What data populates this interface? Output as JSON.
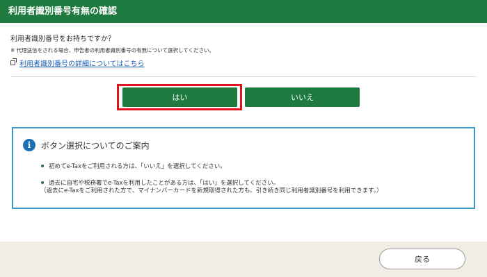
{
  "header": {
    "title": "利用者識別番号有無の確認"
  },
  "main": {
    "question": "利用者識別番号をお持ちですか？",
    "note": "※ 代理送信をされる場合、申告者の利用者識別番号の有無について選択してください。",
    "details_link": "利用者識別番号の詳細についてはこちら",
    "yes_label": "はい",
    "no_label": "いいえ"
  },
  "guide": {
    "title": "ボタン選択についてのご案内",
    "items": [
      "初めてe-Taxをご利用される方は、「いいえ」を選択してください。",
      "過去に自宅や税務署でe-Taxを利用したことがある方は、「はい」を選択してください。"
    ],
    "sub": "（過去にe-Taxをご利用された方で、マイナンバーカードを新規取得された方も、引き続き同じ利用者識別番号を利用できます。）"
  },
  "footer": {
    "back_label": "戻る"
  },
  "colors": {
    "brand_green": "#1f7a3f",
    "highlight_red": "#e0141c",
    "info_blue": "#1b6fb3",
    "footer_bg": "#f1ede4"
  },
  "icons": {
    "link": "external-link-icon",
    "info": "info-icon"
  }
}
